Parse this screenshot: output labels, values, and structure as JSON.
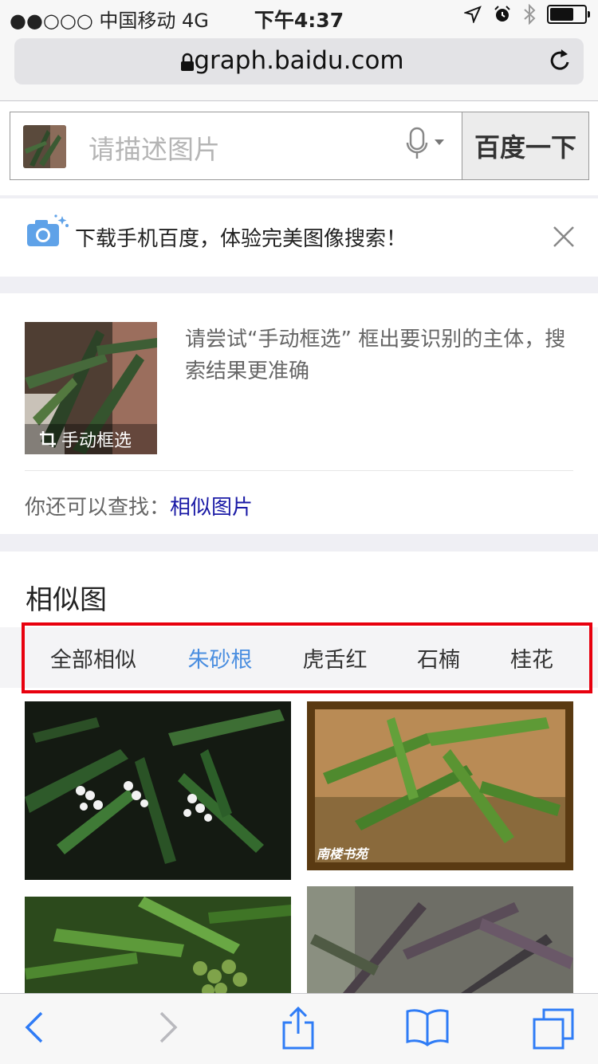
{
  "status_bar": {
    "carrier": "●●○○○ 中国移动  4G",
    "time": "下午4:37",
    "icons": [
      "location-icon",
      "alarm-icon",
      "bluetooth-icon",
      "battery-icon"
    ],
    "battery_level": 0.75
  },
  "browser": {
    "url": "graph.baidu.com"
  },
  "search": {
    "placeholder": "请描述图片",
    "button_label": "百度一下"
  },
  "banner": {
    "text": "下载手机百度，体验完美图像搜索！"
  },
  "card": {
    "crop_label": "手动框选",
    "tip": "请尝试“手动框选” 框出要识别的主体，搜索结果更准确",
    "also_label": "你还可以查找：",
    "also_link": "相似图片"
  },
  "similar": {
    "title": "相似图",
    "tabs": [
      {
        "label": "全部相似",
        "active": false
      },
      {
        "label": "朱砂根",
        "active": true
      },
      {
        "label": "虎舌红",
        "active": false
      },
      {
        "label": "石楠",
        "active": false
      },
      {
        "label": "桂花",
        "active": false
      }
    ],
    "watermark": "南楼书苑"
  },
  "colors": {
    "accent": "#4a8ee0",
    "link": "#1a1aa6",
    "highlight_box": "#e8000e",
    "ios_blue": "#2f7cf6"
  }
}
